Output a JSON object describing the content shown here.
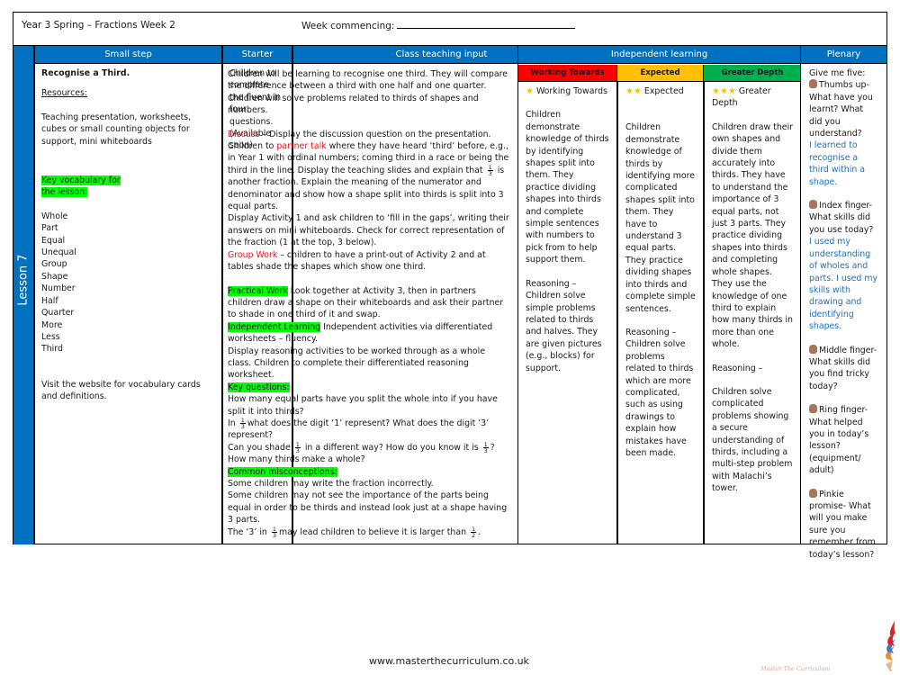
{
  "header": {
    "title": "Year 3 Spring – Fractions Week 2",
    "week_commencing_label": "Week commencing:"
  },
  "lesson": {
    "label": "Lesson 7"
  },
  "columns": {
    "small_step": "Small step",
    "starter": "Starter",
    "class_teaching": "Class teaching input",
    "independent": "Independent learning",
    "plenary": "Plenary"
  },
  "levels": {
    "working_towards": {
      "label": "Working Towards",
      "color": "#ff0000",
      "stars": 1
    },
    "expected": {
      "label": "Expected",
      "color": "#ffc000",
      "stars": 2
    },
    "greater_depth": {
      "label": "Greater Depth",
      "color": "#00b050",
      "stars": 3
    }
  },
  "small_step": {
    "title": "Recognise a Third.",
    "resources_label": "Resources:",
    "resources": "Teaching presentation, worksheets, cubes or small counting objects for support, mini whiteboards",
    "vocab_label": "Key vocabulary for the lesson:",
    "vocab": [
      "Whole",
      "Part",
      "Equal",
      "Unequal",
      "Group",
      "Shape",
      "Number",
      "Half",
      "Quarter",
      "More",
      "Less",
      "Third"
    ],
    "website_note": "Visit the website for vocabulary cards and definitions."
  },
  "starter": {
    "text": "Children to complete the fluent in four questions. (Available soon)"
  },
  "teaching": {
    "intro": "Children will be learning to recognise one third. They will compare the difference between a third with one half and one quarter. Children will solve problems related to thirds of shapes and numbers.",
    "discuss_label": "Discuss",
    "discuss_a": " – Display the discussion question on the presentation. Children to ",
    "partner_talk": "partner talk",
    "discuss_b": " where they have heard ‘third’ before, e.g., in Year 1 with ordinal numbers; coming third in a race or being the third in the line. Display the teaching slides and explain that",
    "discuss_c": "is another fraction. Explain the meaning of the numerator and denominator and show how a shape split into thirds is split into 3 equal parts.",
    "activity1": "Display Activity 1 and ask children to ‘fill in the gaps’, writing their answers on mini whiteboards. Check for correct representation of the fraction (1 at the top, 3 below).",
    "group_label": "Group Work",
    "group_text": " – children to have a print-out of Activity 2 and at tables shade the shapes which show one third.",
    "practical_label": "Practical Work",
    "practical_text": " Look together at Activity 3, then in partners children draw a shape on their whiteboards and ask their partner to shade in one third of it and swap.",
    "independent_label": "Independent Learning",
    "independent_text": " Independent activities via differentiated worksheets – fluency.",
    "reasoning_text": "Display reasoning activities to be worked through as a whole class. Children to complete their differentiated reasoning worksheet.",
    "key_questions_label": "Key questions:",
    "q1": "How many equal parts have you split the whole into if you have split it into thirds?",
    "q2_a": "In",
    "q2_b": "what does the digit ‘1’ represent? What does the digit ‘3’ represent?",
    "q3_a": "Can you shade",
    "q3_b": "in a different way? How do you know it is",
    "q3_c": "?",
    "q4": "How many thirds make a whole?",
    "misconceptions_label": "Common misconceptions:",
    "m1": "Some children may write the fraction incorrectly.",
    "m2": "Some children may not see the importance of the parts being equal in order to be thirds and instead look just at a shape having 3 parts.",
    "m3_a": "The ‘3’ in",
    "m3_b": "may lead children to believe it is larger than",
    "m3_c": ".",
    "fraction_third": {
      "num": "1",
      "den": "3"
    },
    "fraction_half": {
      "num": "1",
      "den": "2"
    }
  },
  "independent": {
    "working_towards": {
      "heading": "Working Towards",
      "body": "Children demonstrate knowledge of thirds by identifying shapes split into them. They practice dividing shapes into thirds and complete simple sentences with numbers to pick from to help support them.",
      "reasoning": "Reasoning – Children solve simple problems related to thirds and halves. They are given pictures (e.g., blocks) for support."
    },
    "expected": {
      "heading": "Expected",
      "body": "Children demonstrate knowledge of thirds by identifying more complicated shapes split into them. They have to understand 3 equal parts. They practice dividing shapes into thirds and complete simple sentences.",
      "reasoning": "Reasoning – Children solve problems related to thirds which are more complicated, such as using drawings to explain how mistakes have been made."
    },
    "greater_depth": {
      "heading": "Greater Depth",
      "body": "Children draw their own shapes and divide them accurately into thirds. They have to understand the importance of 3 equal parts, not just 3 parts. They practice dividing shapes into thirds and completing whole shapes. They use the knowledge of one third to explain how many thirds in more than one whole.",
      "reasoning_label": "Reasoning –",
      "reasoning": "Children solve complicated problems showing a secure understanding of thirds, including a multi-step problem with Malachi’s tower."
    }
  },
  "plenary": {
    "intro": "Give me five:",
    "items": [
      {
        "prompt": "Thumbs up- What have you learnt? What did you understand?",
        "answer": "I learned to recognise a third within a shape."
      },
      {
        "prompt": "Index finger- What skills did you use today?",
        "answer": "I used my understanding of wholes and parts. I used my skills with drawing and identifying shapes."
      },
      {
        "prompt": "Middle finger- What skills did you find tricky today?",
        "answer": ""
      },
      {
        "prompt": "Ring finger- What helped you in today’s lesson? (equipment/ adult)",
        "answer": ""
      },
      {
        "prompt": "Pinkie promise- What will you make sure you remember from today’s lesson?",
        "answer": ""
      }
    ]
  },
  "footer": {
    "url": "www.masterthecurriculum.co.uk",
    "logo_text": "Master The Curriculum"
  }
}
